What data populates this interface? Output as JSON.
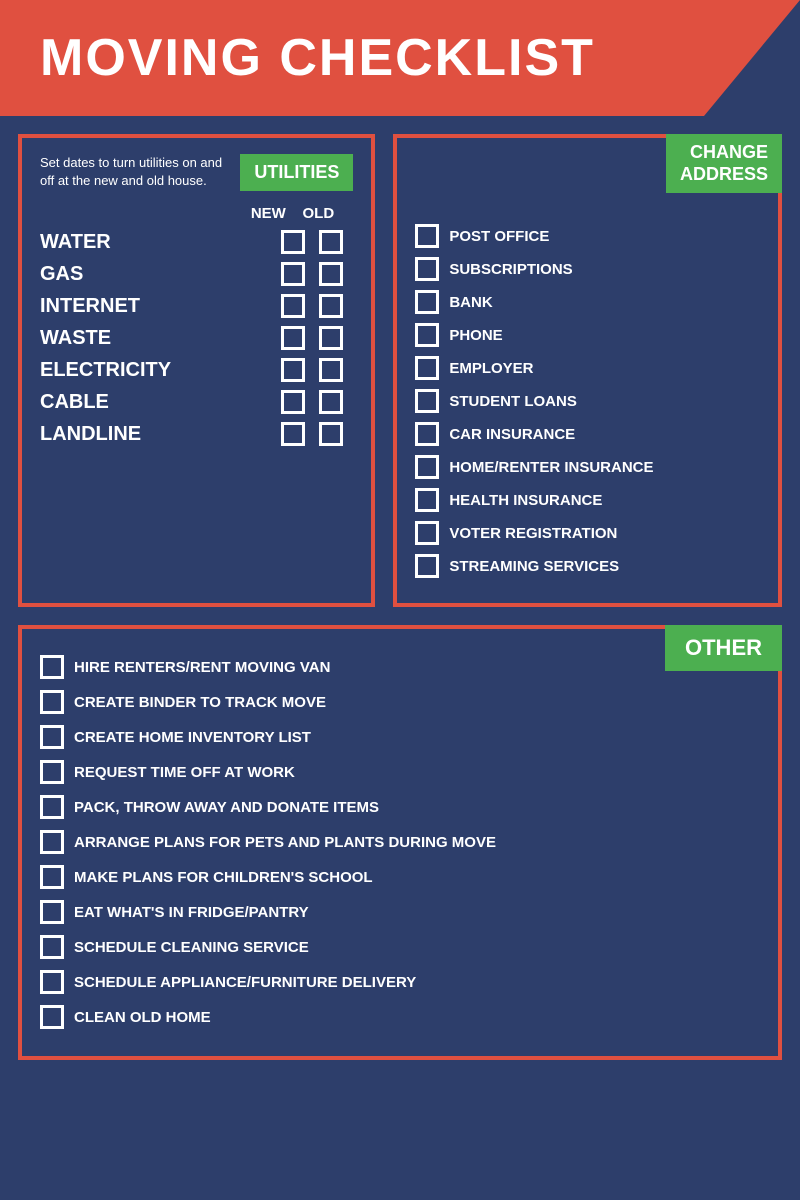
{
  "header": {
    "title": "MOVING CHECKLIST"
  },
  "utilities": {
    "section_label": "UTILITIES",
    "description": "Set dates to turn utilities on and off at the new and old house.",
    "col_new": "NEW",
    "col_old": "OLD",
    "items": [
      {
        "label": "WATER"
      },
      {
        "label": "GAS"
      },
      {
        "label": "INTERNET"
      },
      {
        "label": "WASTE"
      },
      {
        "label": "ELECTRICITY"
      },
      {
        "label": "CABLE"
      },
      {
        "label": "LANDLINE"
      }
    ]
  },
  "change_address": {
    "section_label": "CHANGE\nADDRESS",
    "items": [
      {
        "label": "POST OFFICE"
      },
      {
        "label": "SUBSCRIPTIONS"
      },
      {
        "label": "BANK"
      },
      {
        "label": "PHONE"
      },
      {
        "label": "EMPLOYER"
      },
      {
        "label": "STUDENT LOANS"
      },
      {
        "label": "CAR INSURANCE"
      },
      {
        "label": "HOME/RENTER INSURANCE"
      },
      {
        "label": "HEALTH INSURANCE"
      },
      {
        "label": "VOTER REGISTRATION"
      },
      {
        "label": "STREAMING SERVICES"
      }
    ]
  },
  "other": {
    "section_label": "OTHER",
    "items": [
      {
        "label": "HIRE RENTERS/RENT MOVING VAN"
      },
      {
        "label": "CREATE BINDER TO TRACK MOVE"
      },
      {
        "label": "CREATE HOME INVENTORY LIST"
      },
      {
        "label": "REQUEST TIME OFF AT WORK"
      },
      {
        "label": "PACK, THROW AWAY AND DONATE ITEMS"
      },
      {
        "label": "ARRANGE PLANS FOR PETS AND PLANTS DURING MOVE"
      },
      {
        "label": "MAKE PLANS FOR CHILDREN'S SCHOOL"
      },
      {
        "label": "EAT WHAT'S IN FRIDGE/PANTRY"
      },
      {
        "label": "SCHEDULE CLEANING SERVICE"
      },
      {
        "label": "SCHEDULE APPLIANCE/FURNITURE DELIVERY"
      },
      {
        "label": "CLEAN OLD HOME"
      }
    ]
  }
}
